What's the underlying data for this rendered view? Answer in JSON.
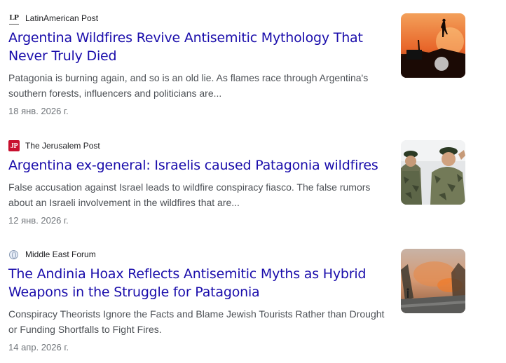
{
  "results": [
    {
      "source": "LatinAmerican Post",
      "favicon_text": "LP",
      "title": "Argentina Wildfires Revive Antisemitic Mythology That Never Truly Died",
      "snippet": "Patagonia is burning again, and so is an old lie. As flames race through Argentina's southern forests, influencers and politicians are...",
      "date": "18 янв. 2026 г."
    },
    {
      "source": "The Jerusalem Post",
      "favicon_text": "JP",
      "title": "Argentina ex-general: Israelis caused Patagonia wildfires",
      "snippet": "False accusation against Israel leads to wildfire conspiracy fiasco. The false rumors about an Israeli involvement in the wildfires that are...",
      "date": "12 янв. 2026 г."
    },
    {
      "source": "Middle East Forum",
      "favicon_text": "",
      "title": "The Andinia Hoax Reflects Antisemitic Myths as Hybrid Weapons in the Struggle for Patagonia",
      "snippet": "Conspiracy Theorists Ignore the Facts and Blame Jewish Tourists Rather than Drought or Funding Shortfalls to Fight Fires.",
      "date": "14 апр. 2026 г."
    }
  ],
  "colors": {
    "title_link": "#1a0dab",
    "snippet_text": "#4d5156",
    "date_text": "#70757a"
  },
  "icons": [
    "latinamerican-post-favicon",
    "jerusalem-post-favicon",
    "globe-icon"
  ]
}
